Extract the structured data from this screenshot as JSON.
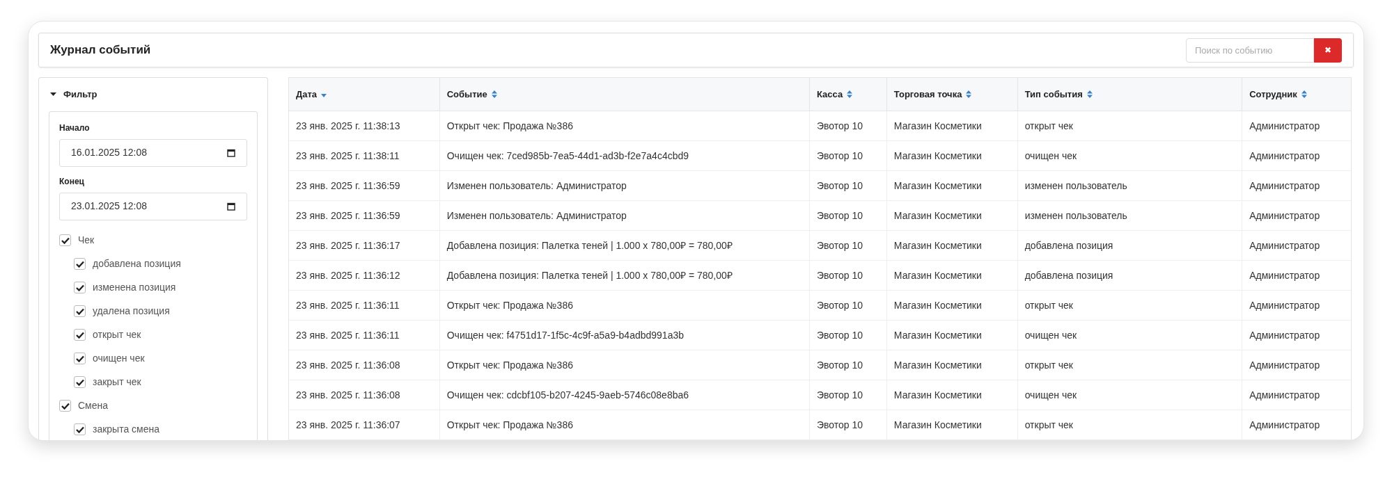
{
  "title": "Журнал событий",
  "search": {
    "placeholder": "Поиск по событию",
    "clear_icon": "✖"
  },
  "filter": {
    "title": "Фильтр",
    "expanded": true,
    "start": {
      "label": "Начало",
      "value": "16.01.2025 12:08"
    },
    "end": {
      "label": "Конец",
      "value": "23.01.2025 12:08"
    },
    "groups": [
      {
        "label": "Чек",
        "checked": true,
        "children": [
          {
            "label": "добавлена позиция",
            "checked": true
          },
          {
            "label": "изменена позиция",
            "checked": true
          },
          {
            "label": "удалена позиция",
            "checked": true
          },
          {
            "label": "открыт чек",
            "checked": true
          },
          {
            "label": "очищен чек",
            "checked": true
          },
          {
            "label": "закрыт чек",
            "checked": true
          }
        ]
      },
      {
        "label": "Смена",
        "checked": true,
        "children": [
          {
            "label": "закрыта смена",
            "checked": true
          }
        ]
      }
    ]
  },
  "table": {
    "columns": [
      {
        "label": "Дата",
        "sorted": true
      },
      {
        "label": "Событие",
        "sorted": false
      },
      {
        "label": "Касса",
        "sorted": false
      },
      {
        "label": "Торговая точка",
        "sorted": false
      },
      {
        "label": "Тип события",
        "sorted": false
      },
      {
        "label": "Сотрудник",
        "sorted": false
      }
    ],
    "rows": [
      [
        "23 янв. 2025 г. 11:38:13",
        "Открыт чек: Продажа №386",
        "Эвотор 10",
        "Магазин Косметики",
        "открыт чек",
        "Администратор"
      ],
      [
        "23 янв. 2025 г. 11:38:11",
        "Очищен чек: 7ced985b-7ea5-44d1-ad3b-f2e7a4c4cbd9",
        "Эвотор 10",
        "Магазин Косметики",
        "очищен чек",
        "Администратор"
      ],
      [
        "23 янв. 2025 г. 11:36:59",
        "Изменен пользователь: Администратор",
        "Эвотор 10",
        "Магазин Косметики",
        "изменен пользователь",
        "Администратор"
      ],
      [
        "23 янв. 2025 г. 11:36:59",
        "Изменен пользователь: Администратор",
        "Эвотор 10",
        "Магазин Косметики",
        "изменен пользователь",
        "Администратор"
      ],
      [
        "23 янв. 2025 г. 11:36:17",
        "Добавлена позиция: Палетка теней | 1.000 x 780,00₽ = 780,00₽",
        "Эвотор 10",
        "Магазин Косметики",
        "добавлена позиция",
        "Администратор"
      ],
      [
        "23 янв. 2025 г. 11:36:12",
        "Добавлена позиция: Палетка теней | 1.000 x 780,00₽ = 780,00₽",
        "Эвотор 10",
        "Магазин Косметики",
        "добавлена позиция",
        "Администратор"
      ],
      [
        "23 янв. 2025 г. 11:36:11",
        "Открыт чек: Продажа №386",
        "Эвотор 10",
        "Магазин Косметики",
        "открыт чек",
        "Администратор"
      ],
      [
        "23 янв. 2025 г. 11:36:11",
        "Очищен чек: f4751d17-1f5c-4c9f-a5a9-b4adbd991a3b",
        "Эвотор 10",
        "Магазин Косметики",
        "очищен чек",
        "Администратор"
      ],
      [
        "23 янв. 2025 г. 11:36:08",
        "Открыт чек: Продажа №386",
        "Эвотор 10",
        "Магазин Косметики",
        "открыт чек",
        "Администратор"
      ],
      [
        "23 янв. 2025 г. 11:36:08",
        "Очищен чек: cdcbf105-b207-4245-9aeb-5746c08e8ba6",
        "Эвотор 10",
        "Магазин Косметики",
        "очищен чек",
        "Администратор"
      ],
      [
        "23 янв. 2025 г. 11:36:07",
        "Открыт чек: Продажа №386",
        "Эвотор 10",
        "Магазин Косметики",
        "открыт чек",
        "Администратор"
      ]
    ]
  }
}
